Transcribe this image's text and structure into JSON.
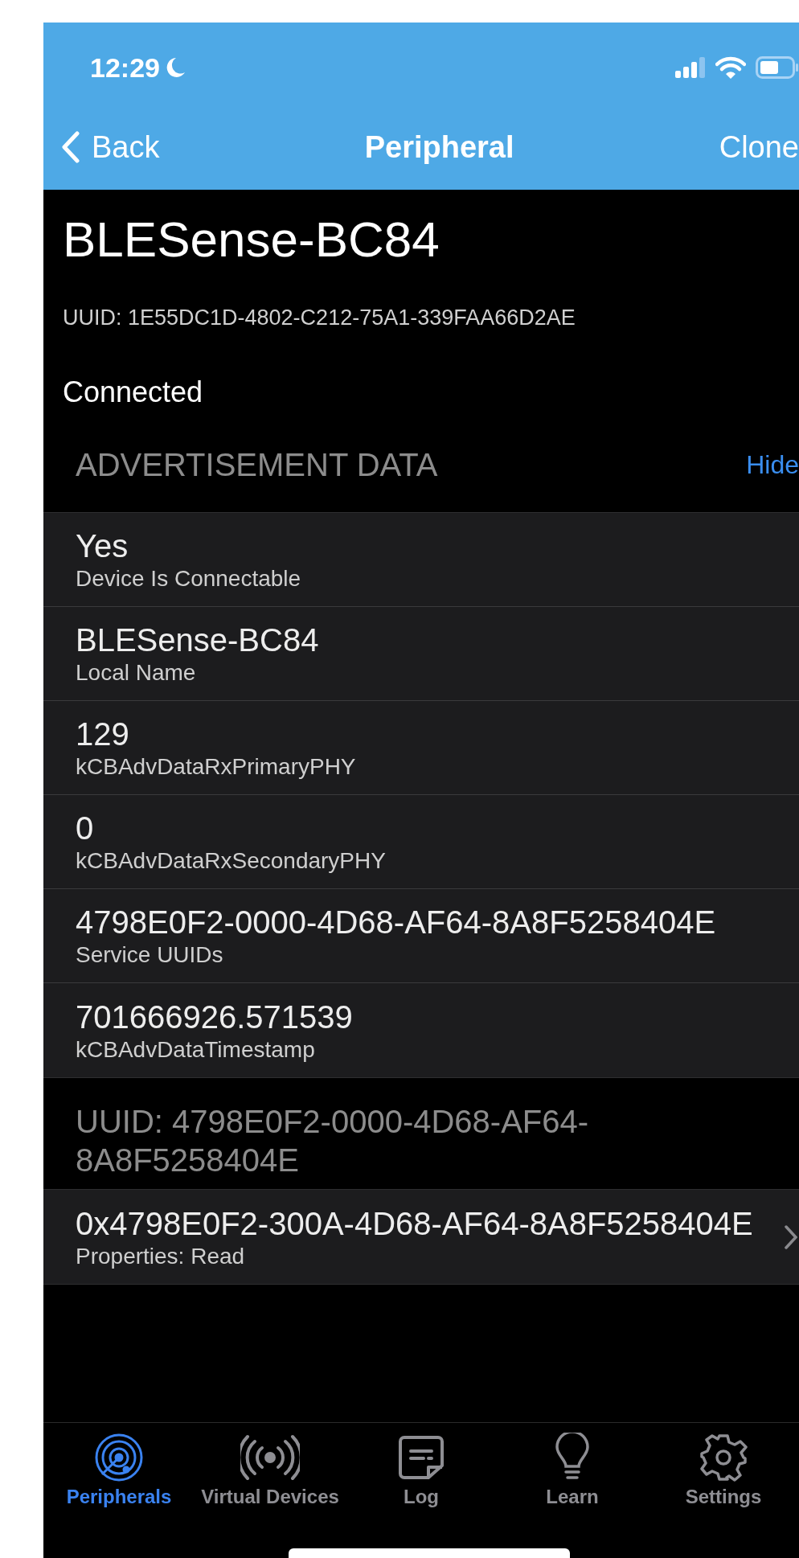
{
  "status_bar": {
    "time": "12:29"
  },
  "nav_bar": {
    "back": "Back",
    "title": "Peripheral",
    "action": "Clone"
  },
  "device": {
    "name": "BLESense-BC84",
    "uuid": "UUID: 1E55DC1D-4802-C212-75A1-339FAA66D2AE",
    "state": "Connected"
  },
  "advertisement": {
    "title": "ADVERTISEMENT DATA",
    "toggle": "Hide",
    "rows": [
      {
        "value": "Yes",
        "label": "Device Is Connectable"
      },
      {
        "value": "BLESense-BC84",
        "label": "Local Name"
      },
      {
        "value": "129",
        "label": "kCBAdvDataRxPrimaryPHY"
      },
      {
        "value": "0",
        "label": "kCBAdvDataRxSecondaryPHY"
      },
      {
        "value": "4798E0F2-0000-4D68-AF64-8A8F5258404E",
        "label": "Service UUIDs"
      },
      {
        "value": "701666926.571539",
        "label": "kCBAdvDataTimestamp"
      }
    ]
  },
  "services": [
    {
      "title": "UUID: 4798E0F2-0000-4D68-AF64-8A8F5258404E",
      "characteristics": [
        {
          "value": "0x4798E0F2-300A-4D68-AF64-8A8F5258404E",
          "label": "Properties: Read"
        }
      ]
    }
  ],
  "tab_bar": [
    {
      "label": "Peripherals",
      "selected": true
    },
    {
      "label": "Virtual Devices",
      "selected": false
    },
    {
      "label": "Log",
      "selected": false
    },
    {
      "label": "Learn",
      "selected": false
    },
    {
      "label": "Settings",
      "selected": false
    }
  ]
}
